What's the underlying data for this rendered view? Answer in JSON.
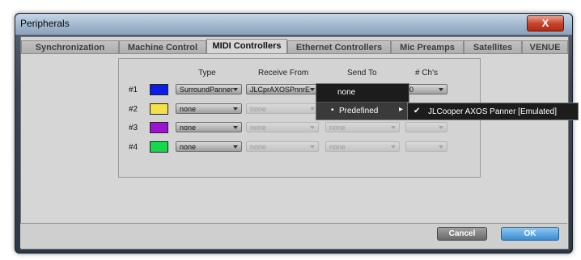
{
  "window": {
    "title": "Peripherals",
    "close_label": "X"
  },
  "tabs": [
    {
      "label": "Synchronization"
    },
    {
      "label": "Machine Control"
    },
    {
      "label": "MIDI Controllers"
    },
    {
      "label": "Ethernet Controllers"
    },
    {
      "label": "Mic Preamps"
    },
    {
      "label": "Satellites"
    },
    {
      "label": "VENUE"
    }
  ],
  "table": {
    "headers": {
      "type": "Type",
      "receive": "Receive From",
      "send": "Send To",
      "chs": "# Ch's"
    },
    "rows": [
      {
        "num": "#1",
        "color": "#0a1ee8",
        "type": "SurroundPanner",
        "receive": "JLCprAXOSPnnrE",
        "send": "",
        "chs": "0"
      },
      {
        "num": "#2",
        "color": "#f5df4a",
        "type": "none",
        "receive": "none",
        "send": "none",
        "chs": ""
      },
      {
        "num": "#3",
        "color": "#a011d6",
        "type": "none",
        "receive": "none",
        "send": "none",
        "chs": ""
      },
      {
        "num": "#4",
        "color": "#16d84a",
        "type": "none",
        "receive": "none",
        "send": "none",
        "chs": ""
      }
    ]
  },
  "menu": {
    "none": "none",
    "predefined": "Predefined",
    "submenu_item": "JLCooper AXOS Panner [Emulated]",
    "check": "✔",
    "bullet": "•",
    "arrow": "▸"
  },
  "buttons": {
    "cancel": "Cancel",
    "ok": "OK"
  }
}
